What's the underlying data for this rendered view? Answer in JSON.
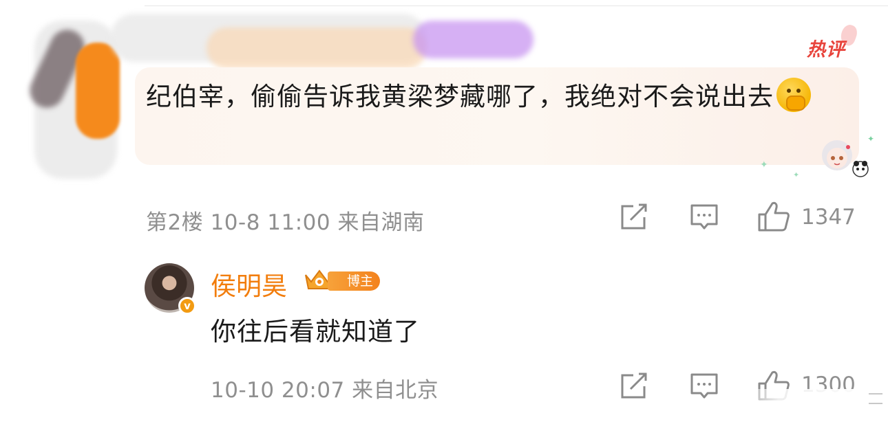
{
  "hot_tag": "热评",
  "comment": {
    "text": "纪伯宰，偷偷告诉我黄梁梦藏哪了，我绝对不会说出去",
    "emoji_icon": "face-with-hand-over-mouth-emoji",
    "floor_meta": "第2楼 10-8 11:00 来自湖南",
    "like_count": "1347"
  },
  "reply": {
    "author": "侯明昊",
    "badge_label": "博主",
    "verified_mark": "v",
    "text": "你往后看就知道了",
    "meta": "10-10 20:07 来自北京",
    "like_count": "1300"
  },
  "colors": {
    "author_orange": "#f27d0c",
    "hot_red": "#e8443c",
    "meta_gray": "#8f8f8f",
    "bubble_bg": "#fdf5ef"
  },
  "icons": [
    "share-icon",
    "comment-icon",
    "thumbs-up-icon"
  ]
}
